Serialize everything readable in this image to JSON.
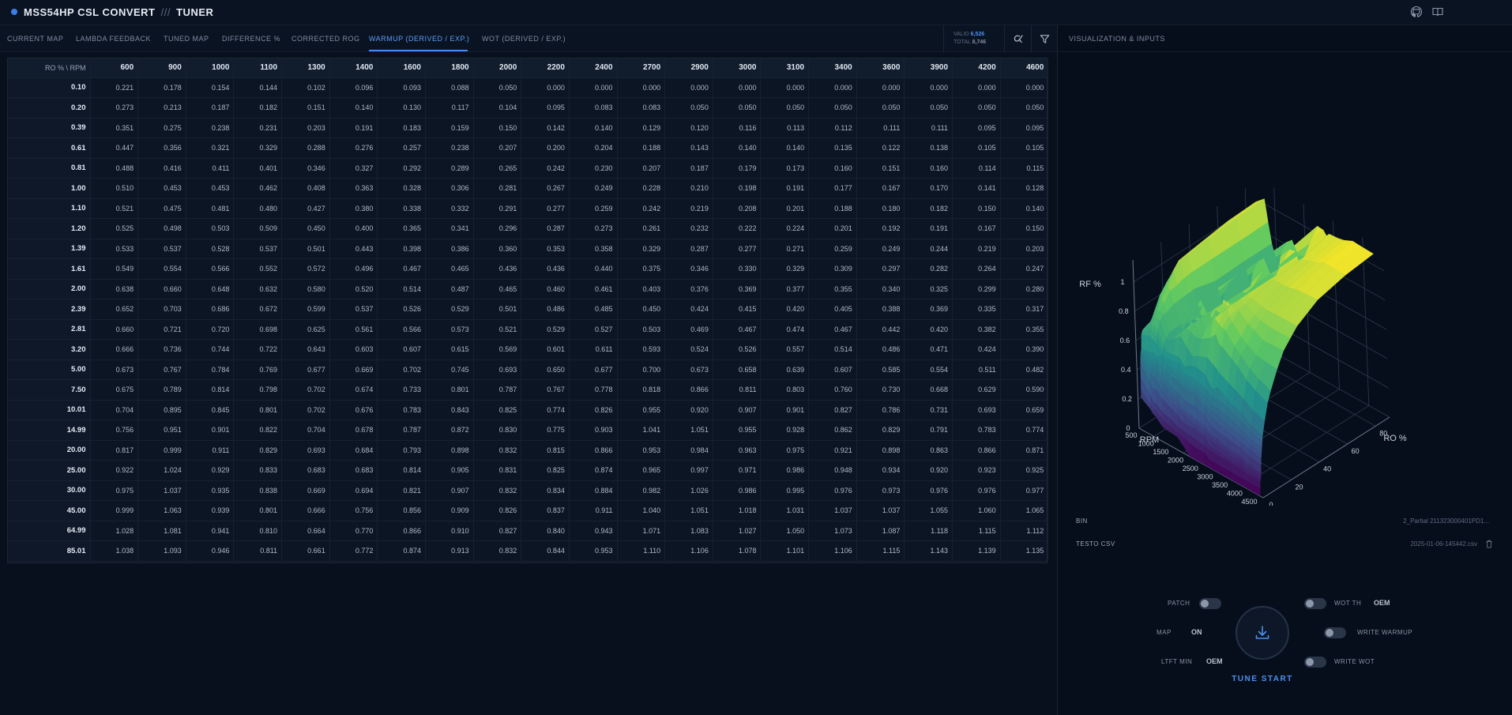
{
  "app": {
    "title_part1": "MSS54HP CSL CONVERT",
    "title_sep": "///",
    "title_part2": "TUNER"
  },
  "header_icons": [
    "github-icon",
    "book-icon"
  ],
  "tabs": [
    {
      "label": "CURRENT MAP",
      "active": false
    },
    {
      "label": "LAMBDA FEEDBACK",
      "active": false
    },
    {
      "label": "TUNED MAP",
      "active": false
    },
    {
      "label": "DIFFERENCE %",
      "active": false
    },
    {
      "label": "CORRECTED ROG",
      "active": false
    },
    {
      "label": "WARMUP (DERIVED / EXP.)",
      "active": true
    },
    {
      "label": "WOT (DERIVED / EXP.)",
      "active": false
    }
  ],
  "counts": {
    "valid_label": "VALID",
    "valid_value": "6,526",
    "total_label": "TOTAL",
    "total_value": "8,746"
  },
  "toolbar_icons": [
    "reset-alpha-icon",
    "filter-icon"
  ],
  "table": {
    "corner": "RO % \\ RPM",
    "rpm": [
      "600",
      "900",
      "1000",
      "1100",
      "1300",
      "1400",
      "1600",
      "1800",
      "2000",
      "2200",
      "2400",
      "2700",
      "2900",
      "3000",
      "3100",
      "3400",
      "3600",
      "3900",
      "4200",
      "4600"
    ],
    "rows": [
      {
        "ro": "0.10",
        "v": [
          "0.221",
          "0.178",
          "0.154",
          "0.144",
          "0.102",
          "0.096",
          "0.093",
          "0.088",
          "0.050",
          "0.000",
          "0.000",
          "0.000",
          "0.000",
          "0.000",
          "0.000",
          "0.000",
          "0.000",
          "0.000",
          "0.000",
          "0.000"
        ]
      },
      {
        "ro": "0.20",
        "v": [
          "0.273",
          "0.213",
          "0.187",
          "0.182",
          "0.151",
          "0.140",
          "0.130",
          "0.117",
          "0.104",
          "0.095",
          "0.083",
          "0.083",
          "0.050",
          "0.050",
          "0.050",
          "0.050",
          "0.050",
          "0.050",
          "0.050",
          "0.050"
        ]
      },
      {
        "ro": "0.39",
        "v": [
          "0.351",
          "0.275",
          "0.238",
          "0.231",
          "0.203",
          "0.191",
          "0.183",
          "0.159",
          "0.150",
          "0.142",
          "0.140",
          "0.129",
          "0.120",
          "0.116",
          "0.113",
          "0.112",
          "0.111",
          "0.111",
          "0.095",
          "0.095"
        ]
      },
      {
        "ro": "0.61",
        "v": [
          "0.447",
          "0.356",
          "0.321",
          "0.329",
          "0.288",
          "0.276",
          "0.257",
          "0.238",
          "0.207",
          "0.200",
          "0.204",
          "0.188",
          "0.143",
          "0.140",
          "0.140",
          "0.135",
          "0.122",
          "0.138",
          "0.105",
          "0.105"
        ]
      },
      {
        "ro": "0.81",
        "v": [
          "0.488",
          "0.416",
          "0.411",
          "0.401",
          "0.346",
          "0.327",
          "0.292",
          "0.289",
          "0.265",
          "0.242",
          "0.230",
          "0.207",
          "0.187",
          "0.179",
          "0.173",
          "0.160",
          "0.151",
          "0.160",
          "0.114",
          "0.115"
        ]
      },
      {
        "ro": "1.00",
        "v": [
          "0.510",
          "0.453",
          "0.453",
          "0.462",
          "0.408",
          "0.363",
          "0.328",
          "0.306",
          "0.281",
          "0.267",
          "0.249",
          "0.228",
          "0.210",
          "0.198",
          "0.191",
          "0.177",
          "0.167",
          "0.170",
          "0.141",
          "0.128"
        ]
      },
      {
        "ro": "1.10",
        "v": [
          "0.521",
          "0.475",
          "0.481",
          "0.480",
          "0.427",
          "0.380",
          "0.338",
          "0.332",
          "0.291",
          "0.277",
          "0.259",
          "0.242",
          "0.219",
          "0.208",
          "0.201",
          "0.188",
          "0.180",
          "0.182",
          "0.150",
          "0.140"
        ]
      },
      {
        "ro": "1.20",
        "v": [
          "0.525",
          "0.498",
          "0.503",
          "0.509",
          "0.450",
          "0.400",
          "0.365",
          "0.341",
          "0.296",
          "0.287",
          "0.273",
          "0.261",
          "0.232",
          "0.222",
          "0.224",
          "0.201",
          "0.192",
          "0.191",
          "0.167",
          "0.150"
        ]
      },
      {
        "ro": "1.39",
        "v": [
          "0.533",
          "0.537",
          "0.528",
          "0.537",
          "0.501",
          "0.443",
          "0.398",
          "0.386",
          "0.360",
          "0.353",
          "0.358",
          "0.329",
          "0.287",
          "0.277",
          "0.271",
          "0.259",
          "0.249",
          "0.244",
          "0.219",
          "0.203"
        ]
      },
      {
        "ro": "1.61",
        "v": [
          "0.549",
          "0.554",
          "0.566",
          "0.552",
          "0.572",
          "0.496",
          "0.467",
          "0.465",
          "0.436",
          "0.436",
          "0.440",
          "0.375",
          "0.346",
          "0.330",
          "0.329",
          "0.309",
          "0.297",
          "0.282",
          "0.264",
          "0.247"
        ]
      },
      {
        "ro": "2.00",
        "v": [
          "0.638",
          "0.660",
          "0.648",
          "0.632",
          "0.580",
          "0.520",
          "0.514",
          "0.487",
          "0.465",
          "0.460",
          "0.461",
          "0.403",
          "0.376",
          "0.369",
          "0.377",
          "0.355",
          "0.340",
          "0.325",
          "0.299",
          "0.280"
        ]
      },
      {
        "ro": "2.39",
        "v": [
          "0.652",
          "0.703",
          "0.686",
          "0.672",
          "0.599",
          "0.537",
          "0.526",
          "0.529",
          "0.501",
          "0.486",
          "0.485",
          "0.450",
          "0.424",
          "0.415",
          "0.420",
          "0.405",
          "0.388",
          "0.369",
          "0.335",
          "0.317"
        ]
      },
      {
        "ro": "2.81",
        "v": [
          "0.660",
          "0.721",
          "0.720",
          "0.698",
          "0.625",
          "0.561",
          "0.566",
          "0.573",
          "0.521",
          "0.529",
          "0.527",
          "0.503",
          "0.469",
          "0.467",
          "0.474",
          "0.467",
          "0.442",
          "0.420",
          "0.382",
          "0.355"
        ]
      },
      {
        "ro": "3.20",
        "v": [
          "0.666",
          "0.736",
          "0.744",
          "0.722",
          "0.643",
          "0.603",
          "0.607",
          "0.615",
          "0.569",
          "0.601",
          "0.611",
          "0.593",
          "0.524",
          "0.526",
          "0.557",
          "0.514",
          "0.486",
          "0.471",
          "0.424",
          "0.390"
        ]
      },
      {
        "ro": "5.00",
        "v": [
          "0.673",
          "0.767",
          "0.784",
          "0.769",
          "0.677",
          "0.669",
          "0.702",
          "0.745",
          "0.693",
          "0.650",
          "0.677",
          "0.700",
          "0.673",
          "0.658",
          "0.639",
          "0.607",
          "0.585",
          "0.554",
          "0.511",
          "0.482"
        ]
      },
      {
        "ro": "7.50",
        "v": [
          "0.675",
          "0.789",
          "0.814",
          "0.798",
          "0.702",
          "0.674",
          "0.733",
          "0.801",
          "0.787",
          "0.767",
          "0.778",
          "0.818",
          "0.866",
          "0.811",
          "0.803",
          "0.760",
          "0.730",
          "0.668",
          "0.629",
          "0.590"
        ]
      },
      {
        "ro": "10.01",
        "v": [
          "0.704",
          "0.895",
          "0.845",
          "0.801",
          "0.702",
          "0.676",
          "0.783",
          "0.843",
          "0.825",
          "0.774",
          "0.826",
          "0.955",
          "0.920",
          "0.907",
          "0.901",
          "0.827",
          "0.786",
          "0.731",
          "0.693",
          "0.659"
        ]
      },
      {
        "ro": "14.99",
        "v": [
          "0.756",
          "0.951",
          "0.901",
          "0.822",
          "0.704",
          "0.678",
          "0.787",
          "0.872",
          "0.830",
          "0.775",
          "0.903",
          "1.041",
          "1.051",
          "0.955",
          "0.928",
          "0.862",
          "0.829",
          "0.791",
          "0.783",
          "0.774"
        ]
      },
      {
        "ro": "20.00",
        "v": [
          "0.817",
          "0.999",
          "0.911",
          "0.829",
          "0.693",
          "0.684",
          "0.793",
          "0.898",
          "0.832",
          "0.815",
          "0.866",
          "0.953",
          "0.984",
          "0.963",
          "0.975",
          "0.921",
          "0.898",
          "0.863",
          "0.866",
          "0.871"
        ]
      },
      {
        "ro": "25.00",
        "v": [
          "0.922",
          "1.024",
          "0.929",
          "0.833",
          "0.683",
          "0.683",
          "0.814",
          "0.905",
          "0.831",
          "0.825",
          "0.874",
          "0.965",
          "0.997",
          "0.971",
          "0.986",
          "0.948",
          "0.934",
          "0.920",
          "0.923",
          "0.925"
        ]
      },
      {
        "ro": "30.00",
        "v": [
          "0.975",
          "1.037",
          "0.935",
          "0.838",
          "0.669",
          "0.694",
          "0.821",
          "0.907",
          "0.832",
          "0.834",
          "0.884",
          "0.982",
          "1.026",
          "0.986",
          "0.995",
          "0.976",
          "0.973",
          "0.976",
          "0.976",
          "0.977"
        ]
      },
      {
        "ro": "45.00",
        "v": [
          "0.999",
          "1.063",
          "0.939",
          "0.801",
          "0.666",
          "0.756",
          "0.856",
          "0.909",
          "0.826",
          "0.837",
          "0.911",
          "1.040",
          "1.051",
          "1.018",
          "1.031",
          "1.037",
          "1.037",
          "1.055",
          "1.060",
          "1.065"
        ]
      },
      {
        "ro": "64.99",
        "v": [
          "1.028",
          "1.081",
          "0.941",
          "0.810",
          "0.664",
          "0.770",
          "0.866",
          "0.910",
          "0.827",
          "0.840",
          "0.943",
          "1.071",
          "1.083",
          "1.027",
          "1.050",
          "1.073",
          "1.087",
          "1.118",
          "1.115",
          "1.112"
        ]
      },
      {
        "ro": "85.01",
        "v": [
          "1.038",
          "1.093",
          "0.946",
          "0.811",
          "0.661",
          "0.772",
          "0.874",
          "0.913",
          "0.832",
          "0.844",
          "0.953",
          "1.110",
          "1.106",
          "1.078",
          "1.101",
          "1.106",
          "1.115",
          "1.143",
          "1.139",
          "1.135"
        ]
      }
    ]
  },
  "panel": {
    "title": "VISUALIZATION & INPUTS",
    "plot": {
      "z_label": "RF %",
      "x_label": "RPM",
      "y_label": "RO %",
      "z_ticks": [
        "0",
        "0.2",
        "0.4",
        "0.6",
        "0.8",
        "1"
      ],
      "x_ticks": [
        "500",
        "1000",
        "1500",
        "2000",
        "2500",
        "3000",
        "3500",
        "4000",
        "4500"
      ],
      "y_ticks": [
        "0",
        "20",
        "40",
        "60",
        "80"
      ],
      "colorscale": [
        "#440154",
        "#3b528b",
        "#21918c",
        "#5ec962",
        "#fde725"
      ]
    },
    "bin_label": "BIN",
    "bin_value": "2_Partial 211323000401PD1...",
    "csv_label": "TESTO CSV",
    "csv_value": "2025-01-06-145442.csv",
    "controls": {
      "patch_label": "PATCH",
      "map_label": "MAP",
      "map_value": "ON",
      "ltft_label": "LTFT MIN",
      "ltft_value": "OEM",
      "wot_th_label": "WOT TH",
      "wot_th_value": "OEM",
      "write_warmup_label": "WRITE WARMUP",
      "write_wot_label": "WRITE WOT",
      "tune_start_label": "TUNE START"
    }
  }
}
